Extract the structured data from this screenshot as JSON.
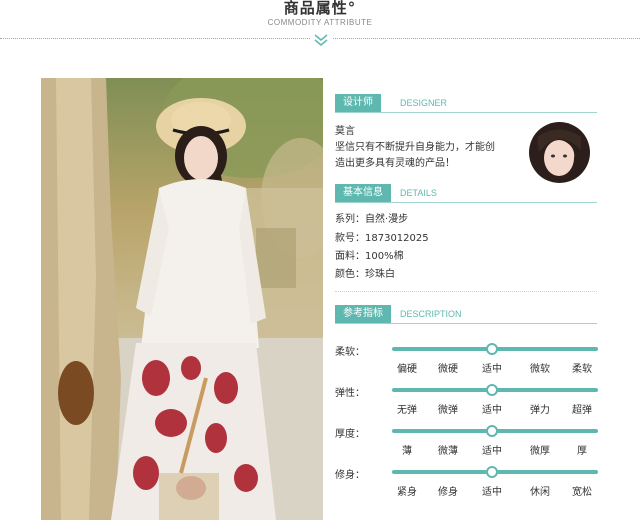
{
  "header": {
    "title": "商品属性°",
    "subtitle": "COMMODITY ATTRIBUTE"
  },
  "designer": {
    "label": "设计师",
    "label_en": "DESIGNER",
    "name": "莫言",
    "bio_line1": "坚信只有不断提升自身能力，才能创",
    "bio_line2": "造出更多具有灵魂的产品！"
  },
  "details": {
    "label": "基本信息",
    "label_en": "DETAILS",
    "series": "系列：自然·漫步",
    "sku": "款号：1873012025",
    "fabric": "面料：100%棉",
    "color": "颜色：珍珠白"
  },
  "description": {
    "label": "参考指标",
    "label_en": "DESCRIPTION",
    "rows": [
      {
        "label": "柔软：",
        "options": [
          "偏硬",
          "微硬",
          "适中",
          "微软",
          "柔软"
        ],
        "selected_index": 2
      },
      {
        "label": "弹性：",
        "options": [
          "无弹",
          "微弹",
          "适中",
          "弹力",
          "超弹"
        ],
        "selected_index": 2
      },
      {
        "label": "厚度：",
        "options": [
          "薄",
          "微薄",
          "适中",
          "微厚",
          "厚"
        ],
        "selected_index": 2
      },
      {
        "label": "修身：",
        "options": [
          "紧身",
          "修身",
          "适中",
          "休闲",
          "宽松"
        ],
        "selected_index": 2
      }
    ]
  },
  "colors": {
    "accent": "#5fb8b0"
  }
}
